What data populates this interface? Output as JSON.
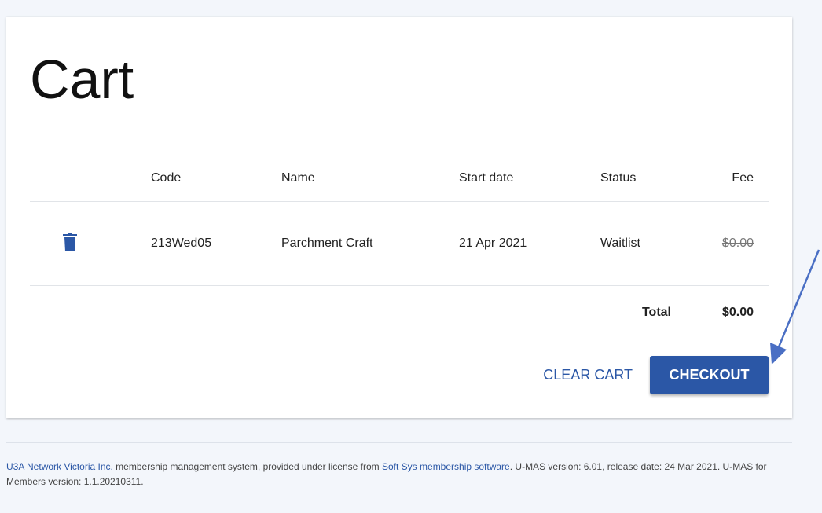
{
  "page": {
    "title": "Cart"
  },
  "table": {
    "headers": {
      "code": "Code",
      "name": "Name",
      "start_date": "Start date",
      "status": "Status",
      "fee": "Fee"
    },
    "rows": [
      {
        "code": "213Wed05",
        "name": "Parchment Craft",
        "start_date": "21 Apr 2021",
        "status": "Waitlist",
        "fee": "$0.00"
      }
    ],
    "total_label": "Total",
    "total_value": "$0.00"
  },
  "actions": {
    "clear_label": "CLEAR CART",
    "checkout_label": "CHECKOUT"
  },
  "footer": {
    "org_link": "U3A Network Victoria Inc.",
    "text_1": " membership management system, provided under license from ",
    "vendor_link": "Soft Sys membership software",
    "text_2": ". U-MAS version: 6.01, release date: 24 Mar 2021. U-MAS for Members version: 1.1.20210311."
  },
  "colors": {
    "primary": "#2b57a6",
    "background": "#f3f6fb",
    "annotation_arrow": "#4a6fc4"
  },
  "icons": {
    "delete": "trash-icon"
  }
}
